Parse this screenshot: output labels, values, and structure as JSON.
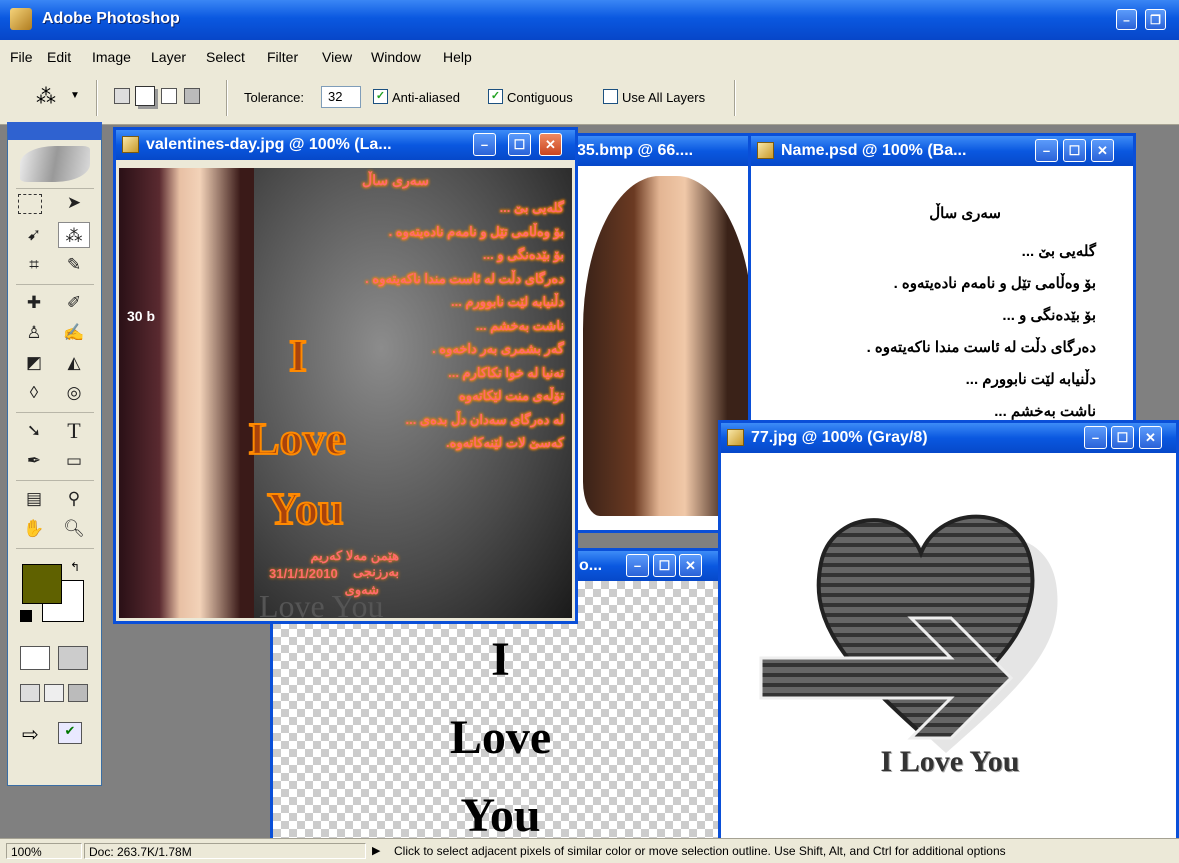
{
  "app": {
    "title": "Adobe Photoshop"
  },
  "menu": [
    "File",
    "Edit",
    "Image",
    "Layer",
    "Select",
    "Filter",
    "View",
    "Window",
    "Help"
  ],
  "options": {
    "tolerance_label": "Tolerance:",
    "tolerance_value": "32",
    "anti_aliased": {
      "label": "Anti-aliased",
      "checked": true
    },
    "contiguous": {
      "label": "Contiguous",
      "checked": true
    },
    "use_all_layers": {
      "label": "Use All Layers",
      "checked": false
    }
  },
  "colors": {
    "foreground": "#5f6100",
    "background": "#ffffff",
    "title_blue": "#0a58e0"
  },
  "windows": {
    "valentines": {
      "title": "valentines-day.jpg @ 100% (La...",
      "heading": "سەری ساڵ",
      "lines": [
        "گلەیی بێ ...",
        "بۆ وەڵامی تێل و نامەم نادەیتەوە .",
        "بۆ بێدەنگی و ...",
        "دەرگای دڵت لە ئاست مندا ناکەیتەوە .",
        "دڵنیابە لێت نابوورم ...",
        "ناشت بەخشم ...",
        "گەر بشمری بەر داخەوە .",
        "تەنیا لە خوا تکاکارم ...",
        "تۆڵەی منت لێکاتەوە",
        "لە دەرگای سەدان دڵ بدەی ...",
        "کەسێ لات لێنەکاتەوە."
      ],
      "big": [
        "I",
        "Love",
        "You"
      ],
      "author": "هێمن مەلا کەریم بەرزنجی",
      "place": "شەوی",
      "date": "31/1/1/2010",
      "footer": "Love You",
      "side_text": "30 b"
    },
    "bmp": {
      "title": "35.bmp @ 66...."
    },
    "name_psd": {
      "title": "Name.psd @ 100% (Ba...",
      "heading": "سەری ساڵ",
      "lines": [
        "گلەیی بێ ...",
        "بۆ وەڵامی تێل و نامەم نادەیتەوە .",
        "بۆ بێدەنگی و ...",
        "دەرگای دڵت لە ئاست مندا ناکەیتەوە .",
        "دڵنیابە لێت نابوورم ...",
        "ناشت بەخشم ..."
      ]
    },
    "gray77": {
      "title": "77.jpg @ 100% (Gray/8)",
      "caption": "I Love You"
    },
    "transparent": {
      "title": "o...",
      "lines": [
        "I",
        "Love",
        "You"
      ]
    }
  },
  "status": {
    "zoom": "100%",
    "doc": "Doc: 263.7K/1.78M",
    "hint": "Click to select adjacent pixels of similar color or move selection outline.  Use Shift, Alt, and Ctrl for additional options"
  }
}
